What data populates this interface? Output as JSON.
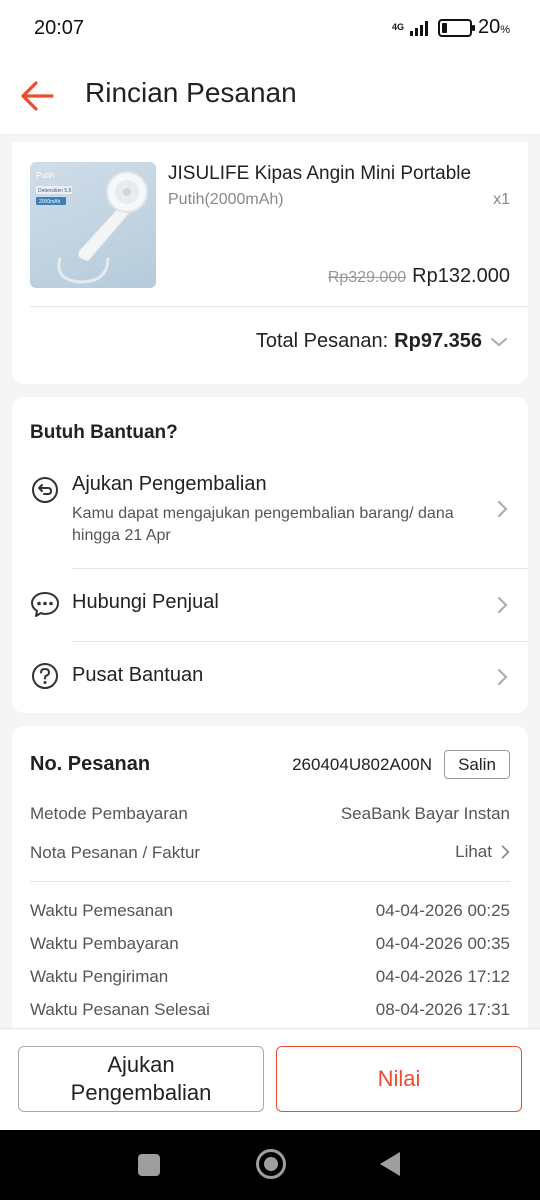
{
  "status": {
    "time": "20:07",
    "network": "4G",
    "battery": "20",
    "battery_unit": "%",
    "battery_level": 0.2
  },
  "header": {
    "title": "Rincian Pesanan"
  },
  "product": {
    "name": "JISULIFE Kipas Angin Mini Portable",
    "variant": "Putih(2000mAh)",
    "qty": "x1",
    "price_original": "Rp329.000",
    "price": "Rp132.000",
    "image_text_brand": "Putih",
    "image_text_1": "Detensitien 5.6",
    "image_text_2": "2000mAh"
  },
  "total": {
    "label": "Total Pesanan:",
    "value": "Rp97.356"
  },
  "help": {
    "title": "Butuh Bantuan?",
    "items": [
      {
        "label": "Ajukan Pengembalian",
        "sub": "Kamu dapat mengajukan pengembalian barang/ dana hingga 21 Apr",
        "icon": "return-icon"
      },
      {
        "label": "Hubungi Penjual",
        "icon": "chat-icon"
      },
      {
        "label": "Pusat Bantuan",
        "icon": "help-circle-icon"
      }
    ]
  },
  "order": {
    "label": "No. Pesanan",
    "number": "260404U802A00N",
    "copy_label": "Salin",
    "payment_label": "Metode Pembayaran",
    "payment_value": "SeaBank Bayar Instan",
    "invoice_label": "Nota Pesanan / Faktur",
    "invoice_value": "Lihat",
    "times": [
      {
        "label": "Waktu Pemesanan",
        "value": "04-04-2026 00:25"
      },
      {
        "label": "Waktu Pembayaran",
        "value": "04-04-2026 00:35"
      },
      {
        "label": "Waktu Pengiriman",
        "value": "04-04-2026 17:12"
      },
      {
        "label": "Waktu Pesanan Selesai",
        "value": "08-04-2026 17:31"
      }
    ]
  },
  "actions": {
    "secondary": "Ajukan Pengembalian",
    "primary": "Nilai"
  },
  "colors": {
    "accent": "#ee4d2d"
  }
}
